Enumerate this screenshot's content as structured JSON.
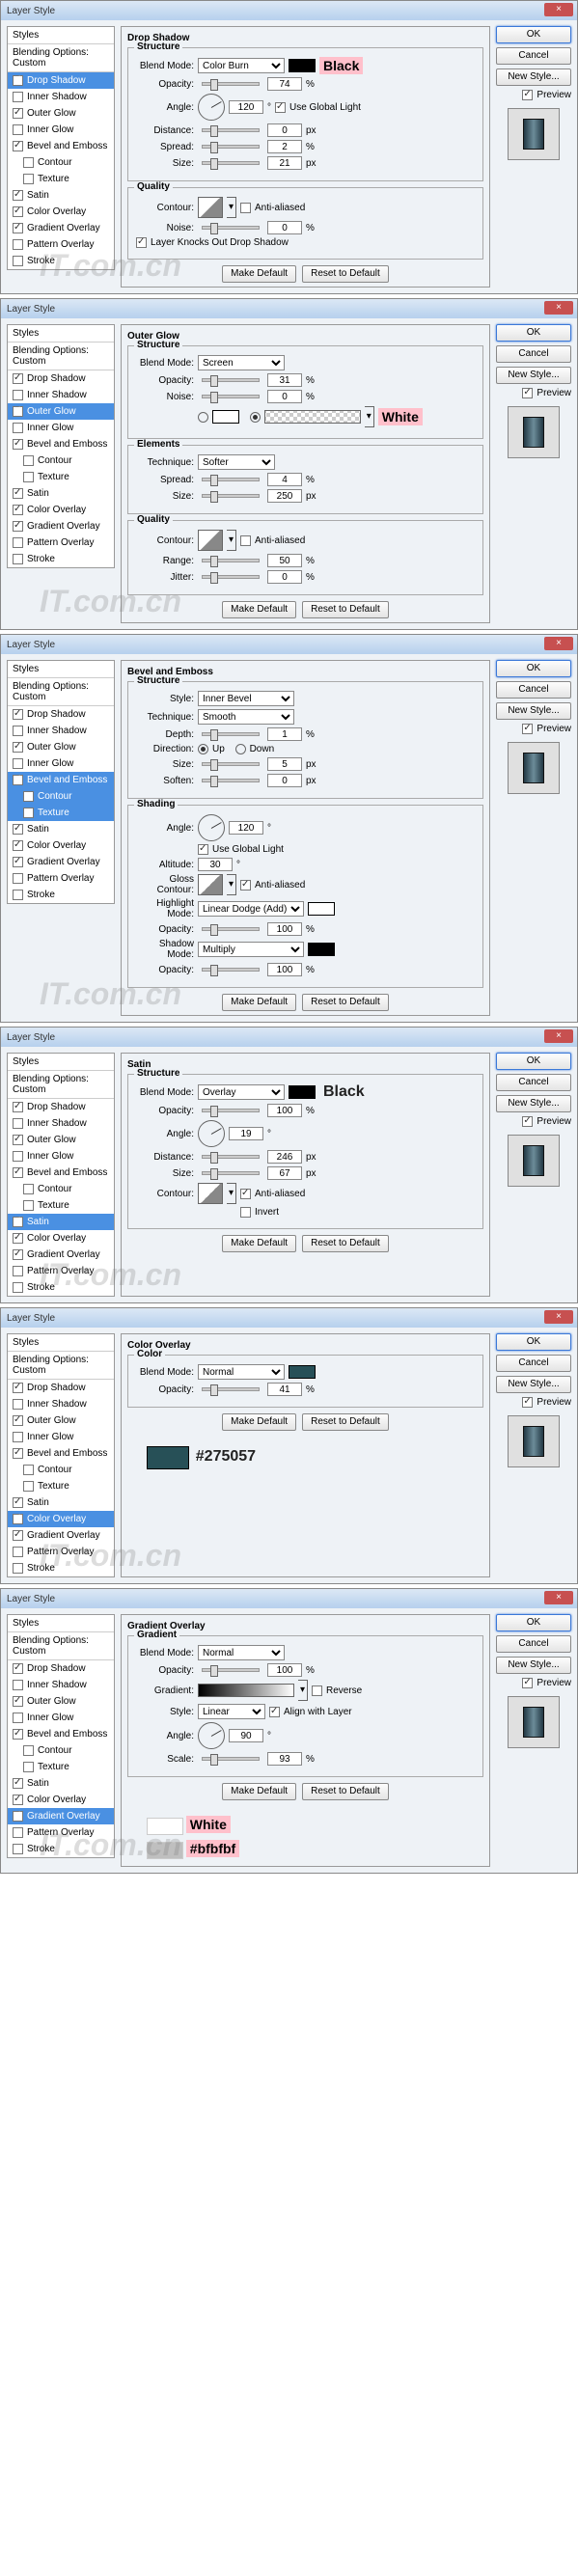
{
  "common": {
    "window_title": "Layer Style",
    "close": "×",
    "ok": "OK",
    "cancel": "Cancel",
    "new_style": "New Style...",
    "preview": "Preview",
    "make_default": "Make Default",
    "reset_default": "Reset to Default",
    "styles_header": "Styles",
    "blending_options": "Blending Options: Custom",
    "structure": "Structure",
    "quality": "Quality",
    "elements": "Elements",
    "shading": "Shading",
    "color": "Color",
    "gradient": "Gradient",
    "blend_mode": "Blend Mode:",
    "opacity": "Opacity:",
    "angle_lbl": "Angle:",
    "distance": "Distance:",
    "spread": "Spread:",
    "size": "Size:",
    "noise": "Noise:",
    "technique": "Technique:",
    "range": "Range:",
    "jitter": "Jitter:",
    "style_lbl": "Style:",
    "depth": "Depth:",
    "direction": "Direction:",
    "up": "Up",
    "down": "Down",
    "soften": "Soften:",
    "altitude": "Altitude:",
    "gloss_contour": "Gloss Contour:",
    "highlight_mode": "Highlight Mode:",
    "shadow_mode": "Shadow Mode:",
    "contour": "Contour:",
    "anti_aliased": "Anti-aliased",
    "use_global_light": "Use Global Light",
    "knocks_out": "Layer Knocks Out Drop Shadow",
    "px": "px",
    "pct": "%",
    "deg": "°",
    "invert": "Invert",
    "reverse": "Reverse",
    "align_layer": "Align with Layer",
    "scale": "Scale:",
    "gradient_lbl": "Gradient:",
    "watermark": "IT.com.cn"
  },
  "styles_list": [
    {
      "key": "drop_shadow",
      "label": "Drop Shadow"
    },
    {
      "key": "inner_shadow",
      "label": "Inner Shadow"
    },
    {
      "key": "outer_glow",
      "label": "Outer Glow"
    },
    {
      "key": "inner_glow",
      "label": "Inner Glow"
    },
    {
      "key": "bevel_emboss",
      "label": "Bevel and Emboss"
    },
    {
      "key": "contour",
      "label": "Contour",
      "sub": true
    },
    {
      "key": "texture",
      "label": "Texture",
      "sub": true
    },
    {
      "key": "satin",
      "label": "Satin"
    },
    {
      "key": "color_overlay",
      "label": "Color Overlay"
    },
    {
      "key": "gradient_overlay",
      "label": "Gradient Overlay"
    },
    {
      "key": "pattern_overlay",
      "label": "Pattern Overlay"
    },
    {
      "key": "stroke",
      "label": "Stroke"
    }
  ],
  "panels": [
    {
      "id": "drop_shadow",
      "title": "Drop Shadow",
      "selected": "drop_shadow",
      "checked": [
        "drop_shadow",
        "outer_glow",
        "bevel_emboss",
        "satin",
        "color_overlay",
        "gradient_overlay"
      ],
      "annot": "Black",
      "annot_style": "pink",
      "data": {
        "blend_mode": "Color Burn",
        "swatch": "black",
        "opacity": 74,
        "angle": 120,
        "use_global_light": true,
        "distance": 0,
        "spread": 2,
        "size": 21,
        "anti_aliased": false,
        "noise": 0,
        "knocks_out": true
      }
    },
    {
      "id": "outer_glow",
      "title": "Outer Glow",
      "selected": "outer_glow",
      "checked": [
        "drop_shadow",
        "outer_glow",
        "bevel_emboss",
        "satin",
        "color_overlay",
        "gradient_overlay"
      ],
      "annot": "White",
      "annot_style": "pink",
      "data": {
        "blend_mode": "Screen",
        "opacity": 31,
        "noise": 0,
        "color_or_gradient": "gradient",
        "technique": "Softer",
        "spread": 4,
        "size": 250,
        "anti_aliased": false,
        "range": 50,
        "jitter": 0
      }
    },
    {
      "id": "bevel_emboss",
      "title": "Bevel and Emboss",
      "selected": "bevel_emboss",
      "sel_extra": [
        "contour",
        "texture"
      ],
      "checked": [
        "drop_shadow",
        "outer_glow",
        "bevel_emboss",
        "satin",
        "color_overlay",
        "gradient_overlay"
      ],
      "data": {
        "style": "Inner Bevel",
        "technique": "Smooth",
        "depth": 1,
        "direction": "Up",
        "size": 5,
        "soften": 0,
        "angle": 120,
        "use_global_light": true,
        "altitude": 30,
        "anti_aliased": true,
        "highlight_mode": "Linear Dodge (Add)",
        "highlight_swatch": "white",
        "highlight_opacity": 100,
        "shadow_mode": "Multiply",
        "shadow_swatch": "black",
        "shadow_opacity": 100
      }
    },
    {
      "id": "satin",
      "title": "Satin",
      "selected": "satin",
      "checked": [
        "drop_shadow",
        "outer_glow",
        "bevel_emboss",
        "satin",
        "color_overlay",
        "gradient_overlay"
      ],
      "annot": "Black",
      "annot_style": "plain",
      "data": {
        "blend_mode": "Overlay",
        "swatch": "black",
        "opacity": 100,
        "angle": 19,
        "distance": 246,
        "size": 67,
        "anti_aliased": true,
        "invert": false
      }
    },
    {
      "id": "color_overlay",
      "title": "Color Overlay",
      "selected": "color_overlay",
      "checked": [
        "drop_shadow",
        "outer_glow",
        "bevel_emboss",
        "satin",
        "color_overlay",
        "gradient_overlay"
      ],
      "annot": "#275057",
      "annot_style": "plain",
      "data": {
        "blend_mode": "Normal",
        "swatch": "teal",
        "opacity": 41,
        "color_hex": "#275057"
      }
    },
    {
      "id": "gradient_overlay",
      "title": "Gradient Overlay",
      "selected": "gradient_overlay",
      "checked": [
        "drop_shadow",
        "outer_glow",
        "bevel_emboss",
        "satin",
        "color_overlay",
        "gradient_overlay"
      ],
      "annot": "White",
      "annot2": "#bfbfbf",
      "annot_style": "pink",
      "data": {
        "blend_mode": "Normal",
        "opacity": 100,
        "reverse": false,
        "style": "Linear",
        "align_layer": true,
        "angle": 90,
        "scale": 93
      }
    }
  ]
}
